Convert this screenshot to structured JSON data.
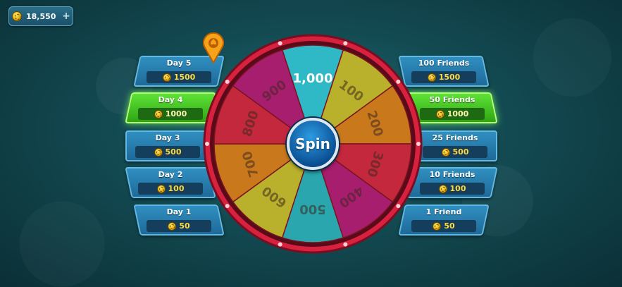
{
  "balance": {
    "amount": "18,550",
    "plus_label": "+"
  },
  "spin_label": "Spin",
  "wheel": {
    "segments": [
      {
        "label": "1,000",
        "color": "#2fb8c6"
      },
      {
        "label": "100",
        "color": "#b9b12c"
      },
      {
        "label": "200",
        "color": "#c9791c"
      },
      {
        "label": "300",
        "color": "#c3283c"
      },
      {
        "label": "400",
        "color": "#a81e6e"
      },
      {
        "label": "500",
        "color": "#2aa7ae"
      },
      {
        "label": "600",
        "color": "#b9b12c"
      },
      {
        "label": "700",
        "color": "#c9791c"
      },
      {
        "label": "800",
        "color": "#c3283c"
      },
      {
        "label": "900",
        "color": "#a81e6e"
      }
    ],
    "rim_color": "#d8213e"
  },
  "day_rewards": [
    {
      "label": "Day 5",
      "reward": "1500",
      "active": false
    },
    {
      "label": "Day 4",
      "reward": "1000",
      "active": true
    },
    {
      "label": "Day 3",
      "reward": "500",
      "active": false
    },
    {
      "label": "Day 2",
      "reward": "100",
      "active": false
    },
    {
      "label": "Day 1",
      "reward": "50",
      "active": false
    }
  ],
  "friend_rewards": [
    {
      "label": "100 Friends",
      "reward": "1500",
      "active": false
    },
    {
      "label": "50 Friends",
      "reward": "1000",
      "active": true
    },
    {
      "label": "25 Friends",
      "reward": "500",
      "active": false
    },
    {
      "label": "10 Friends",
      "reward": "100",
      "active": false
    },
    {
      "label": "1 Friend",
      "reward": "50",
      "active": false
    }
  ]
}
